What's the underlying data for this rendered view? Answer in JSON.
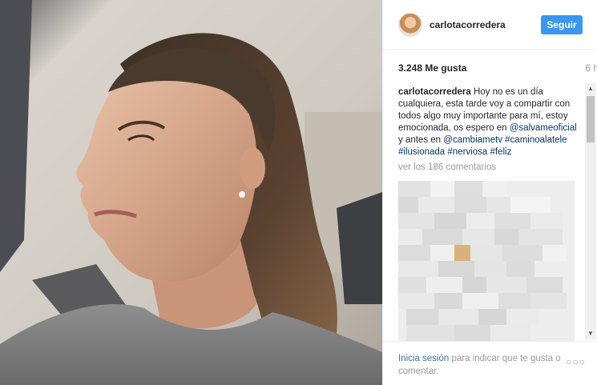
{
  "post": {
    "username": "carlotacorredera",
    "follow_label": "Seguir",
    "likes": "3.248 Me gusta",
    "time_ago": "6 h",
    "caption": {
      "user": "carlotacorredera",
      "text_1": "Hoy no es un día cualquiera, esta tarde voy a compartir con todos algo muy importante para mí, estoy emocionada, os espero en",
      "mention": "@salvameoficial",
      "text_2": "y antes en",
      "tags": [
        "@cambiametv",
        "#caminoalatele",
        "#ilusionada",
        "#nerviosa",
        "#feliz"
      ]
    },
    "view_comments": "ver los 186 comentarios"
  },
  "footer": {
    "login_link": "Inicia sesión",
    "prompt": "para indicar que te gusta o comentar.",
    "more_label": "○○○"
  },
  "icons": {
    "scroll_up": "scroll-up-arrow-icon",
    "scroll_down": "scroll-down-arrow-icon",
    "more": "more-options-icon"
  },
  "colors": {
    "accent": "#3897f0",
    "link": "#003569",
    "login_link": "#3f729b",
    "muted": "#999999"
  }
}
